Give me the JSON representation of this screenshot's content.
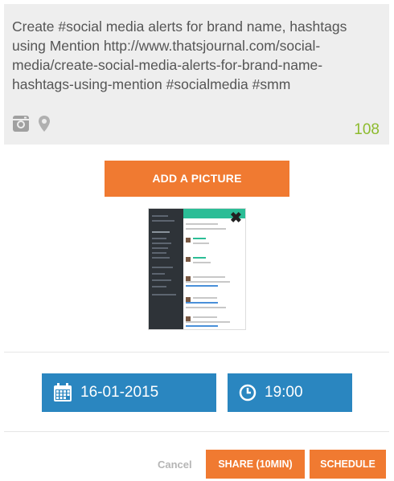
{
  "composer": {
    "text": "Create #social media alerts for brand name, hashtags using Mention http://www.thatsjournal.com/social-media/create-social-media-alerts-for-brand-name-hashtags-using-mention #socialmedia #smm",
    "char_count": "108",
    "icons": [
      "instagram-icon",
      "location-pin-icon"
    ]
  },
  "picture": {
    "add_label": "ADD A PICTURE"
  },
  "schedule": {
    "date": "16-01-2015",
    "time": "19:00"
  },
  "actions": {
    "cancel": "Cancel",
    "share": "SHARE (10MIN)",
    "schedule": "SCHEDULE"
  },
  "colors": {
    "accent": "#f07a31",
    "blue": "#2a86c0",
    "count": "#8dbb2e"
  }
}
